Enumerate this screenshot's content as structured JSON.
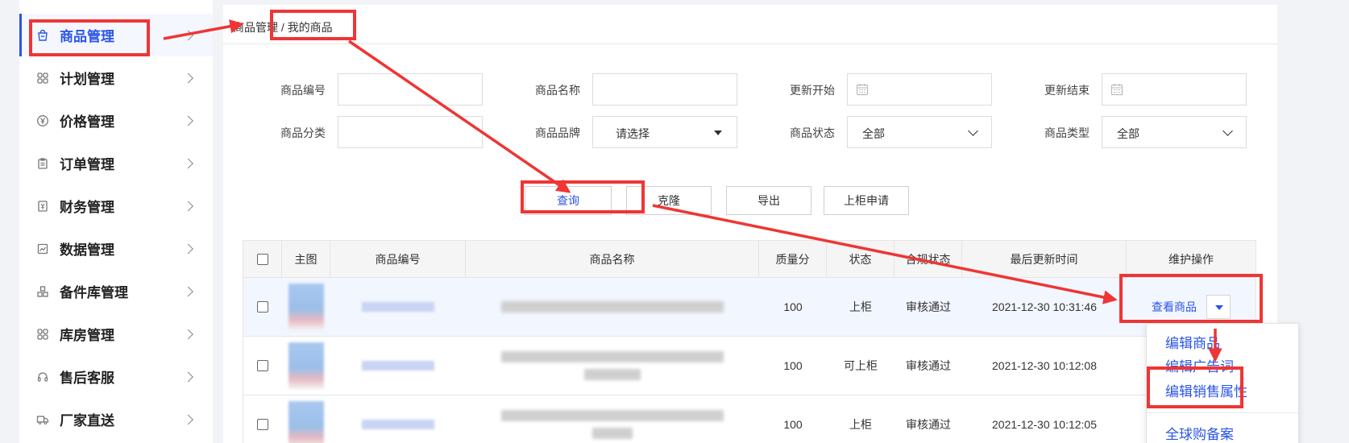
{
  "sidebar": {
    "items": [
      {
        "label": "商品管理",
        "icon": "bag-icon",
        "active": true
      },
      {
        "label": "计划管理",
        "icon": "grid-icon"
      },
      {
        "label": "价格管理",
        "icon": "yen-circle-icon"
      },
      {
        "label": "订单管理",
        "icon": "clipboard-icon"
      },
      {
        "label": "财务管理",
        "icon": "yen-doc-icon"
      },
      {
        "label": "数据管理",
        "icon": "chart-icon"
      },
      {
        "label": "备件库管理",
        "icon": "boxes-icon"
      },
      {
        "label": "库房管理",
        "icon": "grid-icon"
      },
      {
        "label": "售后客服",
        "icon": "headset-icon"
      },
      {
        "label": "厂家直送",
        "icon": "truck-icon"
      }
    ]
  },
  "breadcrumb": "商品管理 / 我的商品",
  "filters": {
    "product_code": {
      "label": "商品编号",
      "value": ""
    },
    "product_name": {
      "label": "商品名称",
      "value": ""
    },
    "update_start": {
      "label": "更新开始",
      "value": ""
    },
    "update_end": {
      "label": "更新结束",
      "value": ""
    },
    "category": {
      "label": "商品分类",
      "value": ""
    },
    "brand": {
      "label": "商品品牌",
      "value": "请选择"
    },
    "status": {
      "label": "商品状态",
      "value": "全部"
    },
    "type": {
      "label": "商品类型",
      "value": "全部"
    }
  },
  "buttons": {
    "query": "查询",
    "clone": "克隆",
    "export": "导出",
    "apply_shelf": "上柜申请"
  },
  "table": {
    "headers": [
      "主图",
      "商品编号",
      "商品名称",
      "质量分",
      "状态",
      "合规状态",
      "最后更新时间",
      "维护操作"
    ],
    "rows": [
      {
        "quality": "100",
        "status": "上柜",
        "compliance": "审核通过",
        "updated": "2021-12-30 10:31:46",
        "action": "查看商品"
      },
      {
        "quality": "100",
        "status": "可上柜",
        "compliance": "审核通过",
        "updated": "2021-12-30 10:12:08",
        "action": ""
      },
      {
        "quality": "100",
        "status": "上柜",
        "compliance": "审核通过",
        "updated": "2021-12-30 10:12:05",
        "action": ""
      }
    ]
  },
  "menu": {
    "items": [
      "编辑商品",
      "编辑广告词",
      "编辑销售属性",
      "全球购备案"
    ]
  },
  "colors": {
    "accent": "#2b55e6",
    "annotation": "#ef3535"
  }
}
